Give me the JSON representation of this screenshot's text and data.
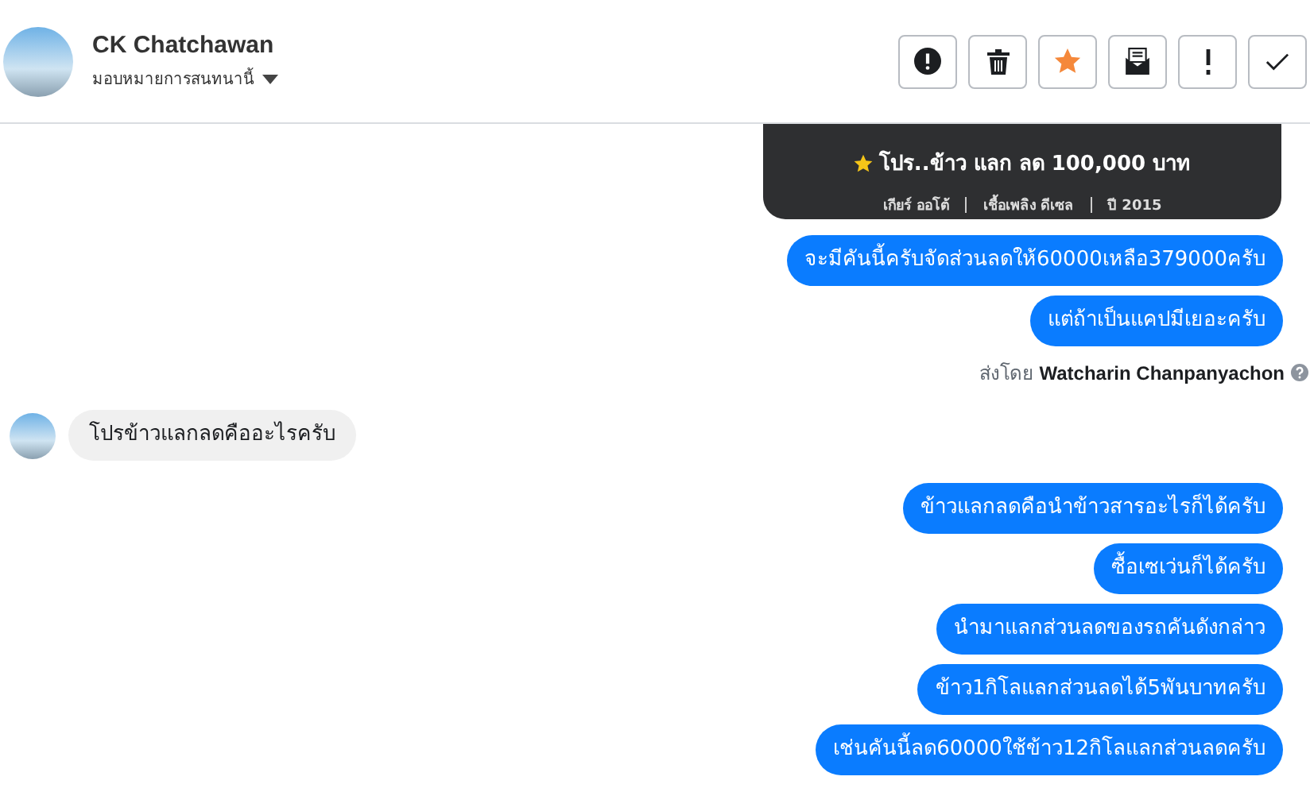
{
  "header": {
    "name": "CK Chatchawan",
    "subtitle": "มอบหมายการสนทนานี้"
  },
  "actions": [
    {
      "kind": "alert"
    },
    {
      "kind": "trash"
    },
    {
      "kind": "star"
    },
    {
      "kind": "mail"
    },
    {
      "kind": "exclaim"
    },
    {
      "kind": "check"
    }
  ],
  "messages": [
    {
      "kind": "card",
      "promo": "โปร..ข้าว แลก ลด 100,000 บาท",
      "specs": [
        "เกียร์ ออโต้",
        "เชื้อเพลิง ดีเซล",
        "ปี 2015"
      ]
    },
    {
      "kind": "outgoing",
      "text": "จะมีคันนี้ครับจัดส่วนลดให้60000เหลือ379000ครับ"
    },
    {
      "kind": "outgoing",
      "text": "แต่ถ้าเป็นแคปมีเยอะครับ"
    },
    {
      "kind": "sender",
      "prefix": "ส่งโดย",
      "name": "Watcharin Chanpanyachon"
    },
    {
      "kind": "incoming",
      "text": "โปรข้าวแลกลดคืออะไรครับ"
    },
    {
      "kind": "outgoing",
      "text": "ข้าวแลกลดคือนำข้าวสารอะไรก็ได้ครับ"
    },
    {
      "kind": "outgoing",
      "text": "ซื้อเซเว่นก็ได้ครับ"
    },
    {
      "kind": "outgoing",
      "text": "นำมาแลกส่วนลดของรถคันดังกล่าว"
    },
    {
      "kind": "outgoing",
      "text": "ข้าว1กิโลแลกส่วนลดได้5พันบาทครับ"
    },
    {
      "kind": "outgoing",
      "text": "เช่นคันนี้ลด60000ใช้ข้าว12กิโลแลกส่วนลดครับ"
    }
  ]
}
